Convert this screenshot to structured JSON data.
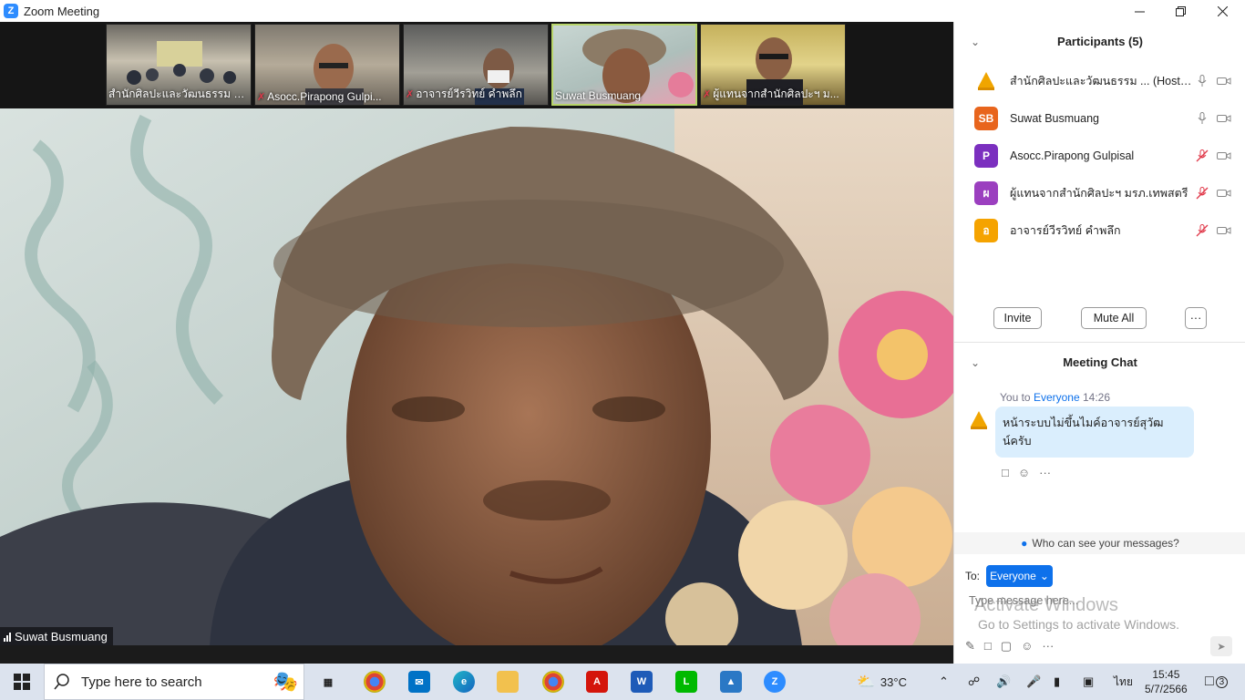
{
  "window": {
    "title": "Zoom Meeting"
  },
  "thumbnails": [
    {
      "name": "สำนักศิลปะและวัฒนธรรม มห...",
      "muted": false,
      "active": false
    },
    {
      "name": "Asocc.Pirapong Gulpi...",
      "muted": true,
      "active": false
    },
    {
      "name": "อาจารย์วีรวิทย์ คำพลึก",
      "muted": true,
      "active": false
    },
    {
      "name": "Suwat Busmuang",
      "muted": false,
      "active": true
    },
    {
      "name": "ผู้แทนจากสำนักศิลปะฯ  ม...",
      "muted": true,
      "active": false
    }
  ],
  "main_video": {
    "speaker_name": "Suwat Busmuang"
  },
  "participants": {
    "header": "Participants (5)",
    "list": [
      {
        "avatar_text": "",
        "avatar_color": "#f0a500",
        "name": "สำนักศิลปะและวัฒนธรรม ... (Host, me)",
        "mic": "on"
      },
      {
        "avatar_text": "SB",
        "avatar_color": "#e8651d",
        "name": "Suwat Busmuang",
        "mic": "on"
      },
      {
        "avatar_text": "P",
        "avatar_color": "#7b2fbf",
        "name": "Asocc.Pirapong Gulpisal",
        "mic": "muted"
      },
      {
        "avatar_text": "ผ",
        "avatar_color": "#9b3fbf",
        "name": "ผู้แทนจากสำนักศิลปะฯ  มรภ.เทพสตรี",
        "mic": "muted"
      },
      {
        "avatar_text": "อ",
        "avatar_color": "#f5a300",
        "name": "อาจารย์วีรวิทย์ คำพลึก",
        "mic": "muted"
      }
    ],
    "invite_label": "Invite",
    "mute_all_label": "Mute All",
    "more_label": "···"
  },
  "chat": {
    "header": "Meeting Chat",
    "messages": [
      {
        "sender": "You",
        "to_word": "to",
        "recipient": "Everyone",
        "time": "14:26",
        "text": "หน้าระบบไม่ขึ้นไมค์อาจารย์สุวัฒ\nน์ครับ"
      }
    ],
    "who_can_see": "Who can see your messages?",
    "to_label": "To:",
    "recipient_button": "Everyone",
    "input_placeholder": "Type message here..."
  },
  "watermark": {
    "line1": "Activate Windows",
    "line2": "Go to Settings to activate Windows."
  },
  "taskbar": {
    "search_placeholder": "Type here to search",
    "weather": "33°C",
    "language": "ไทย",
    "time": "15:45",
    "date": "5/7/2566",
    "notification_count": "3"
  },
  "colors": {
    "zoom_blue": "#0e71eb",
    "muted_red": "#e0394a",
    "active_border": "#b8d56a"
  }
}
